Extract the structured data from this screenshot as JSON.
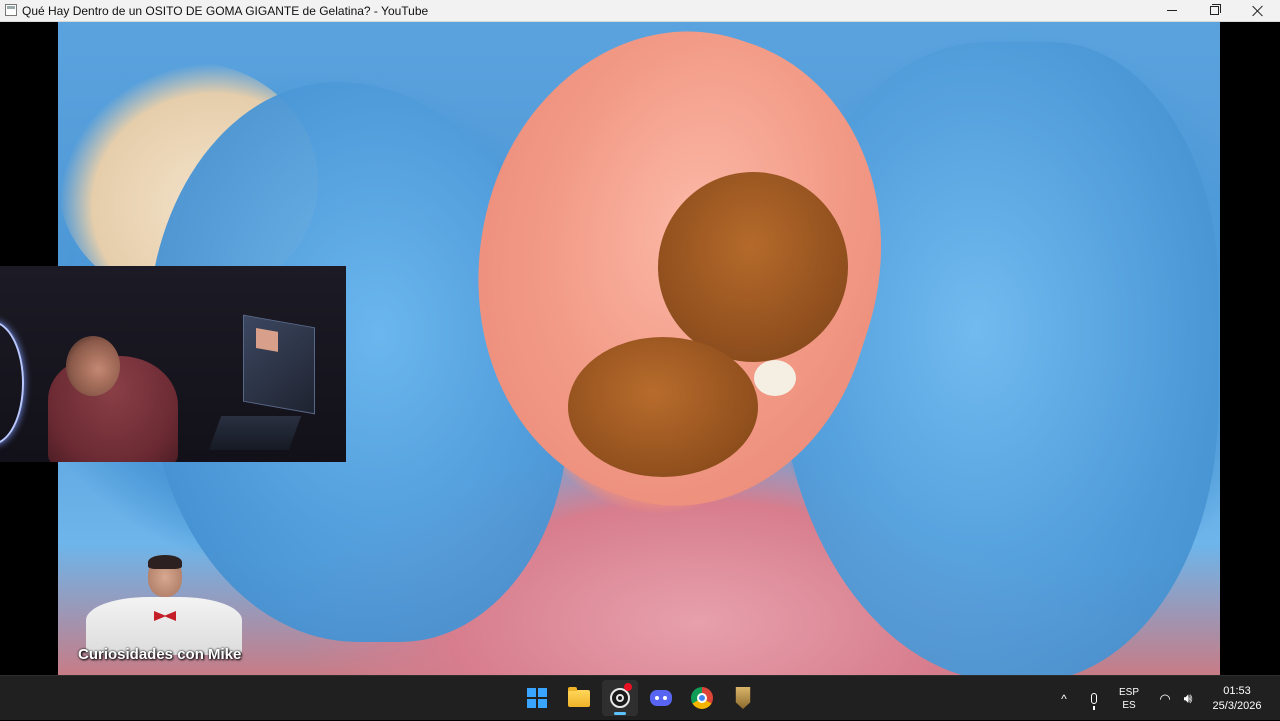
{
  "window": {
    "title": "Qué Hay Dentro de un OSITO DE GOMA GIGANTE de Gelatina? - YouTube",
    "minimize_icon": "minimize-icon",
    "maximize_icon": "restore-icon",
    "close_icon": "close-icon"
  },
  "video": {
    "watermark_channel": "Curiosidades con Mike"
  },
  "taskbar": {
    "apps": [
      {
        "name": "Start",
        "icon": "windows-start-icon"
      },
      {
        "name": "File Explorer",
        "icon": "folder-icon"
      },
      {
        "name": "OBS Studio",
        "icon": "obs-icon",
        "recording": true,
        "active": true
      },
      {
        "name": "Discord",
        "icon": "discord-icon"
      },
      {
        "name": "Google Chrome",
        "icon": "chrome-icon"
      },
      {
        "name": "League of Legends",
        "icon": "league-icon"
      }
    ],
    "tray": {
      "overflow_symbol": "^",
      "language_line1": "ESP",
      "language_line2": "ES",
      "time": "01:53",
      "date": "25/3/2026"
    }
  },
  "colors": {
    "taskbar_bg": "#202020",
    "titlebar_bg": "#f2f2f2",
    "accent": "#5cc3ff",
    "record_dot": "#e81123"
  }
}
